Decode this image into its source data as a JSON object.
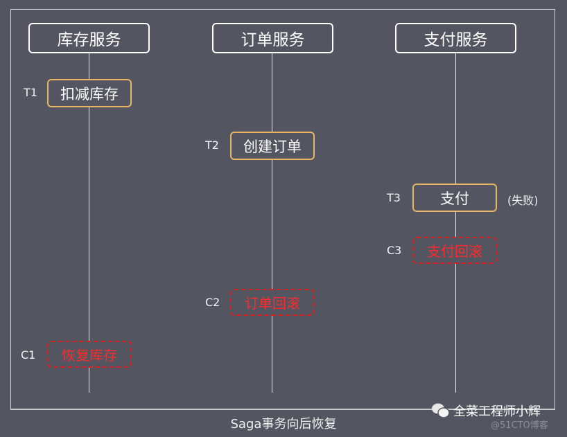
{
  "services": [
    "库存服务",
    "订单服务",
    "支付服务"
  ],
  "steps": [
    {
      "label": "T1",
      "text": "扣减库存"
    },
    {
      "label": "T2",
      "text": "创建订单"
    },
    {
      "label": "T3",
      "text": "支付",
      "note": "(失败)"
    }
  ],
  "compensations": [
    {
      "label": "C3",
      "text": "支付回滚"
    },
    {
      "label": "C2",
      "text": "订单回滚"
    },
    {
      "label": "C1",
      "text": "恢复库存"
    }
  ],
  "caption": "Saga事务向后恢复",
  "watermark": {
    "author": "全菜工程师小辉",
    "site": "@51CTO博客"
  },
  "colors": {
    "background": "#535661",
    "step_border": "#e8b564",
    "compensation": "#e02020"
  }
}
